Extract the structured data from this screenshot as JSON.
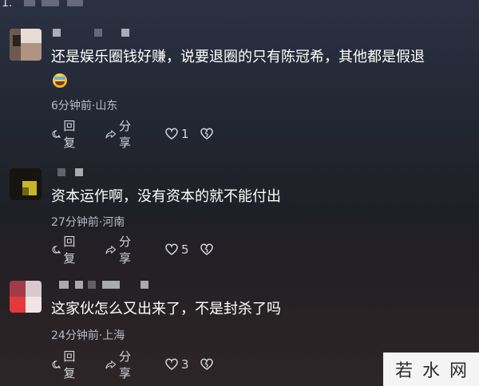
{
  "top_marker": "1.",
  "comments": [
    {
      "text": "还是娱乐圈钱好赚，说要退圈的只有陈冠希，其他都是假退",
      "has_emoji": true,
      "emoji_name": "crying-laughing-emoji",
      "time_location": "6分钟前·山东",
      "reply_label": "回复",
      "share_label": "分享",
      "like_count": "1"
    },
    {
      "text": "资本运作啊，没有资本的就不能付出",
      "has_emoji": false,
      "time_location": "27分钟前·河南",
      "reply_label": "回复",
      "share_label": "分享",
      "like_count": "5"
    },
    {
      "text": "这家伙怎么又出来了，不是封杀了吗",
      "has_emoji": false,
      "time_location": "24分钟前·上海",
      "reply_label": "回复",
      "share_label": "分享",
      "like_count": "3"
    }
  ],
  "watermark": "若水网"
}
